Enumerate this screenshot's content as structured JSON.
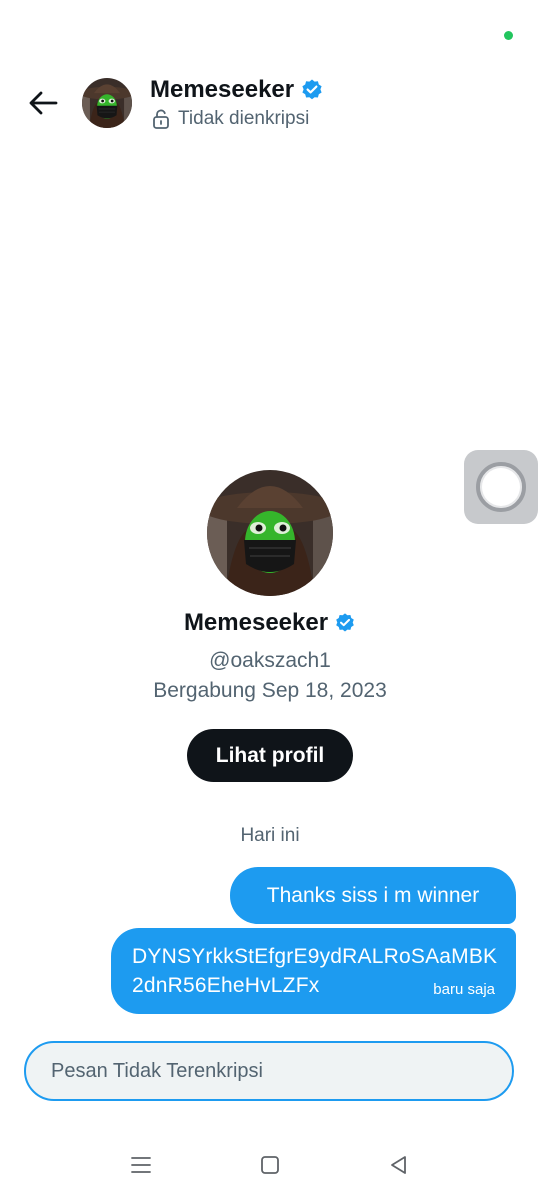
{
  "colors": {
    "accent": "#1d9bf0",
    "text": "#0f1419",
    "muted": "#536471",
    "status_dot": "#22c55e"
  },
  "header": {
    "name": "Memeseeker",
    "verified_icon": "verified-badge-icon",
    "encryption_icon": "unlocked-padlock-icon",
    "encryption_status": "Tidak dienkripsi"
  },
  "profile": {
    "name": "Memeseeker",
    "handle": "@oakszach1",
    "joined": "Bergabung Sep 18, 2023",
    "view_profile_label": "Lihat profil"
  },
  "conversation": {
    "day_label": "Hari ini",
    "messages": [
      {
        "text": "Thanks siss i m winner"
      },
      {
        "text": "DYNSYrkkStEfgrE9ydRALRoSAaMBK2dnR56EheHvLZFx",
        "time": "baru saja"
      }
    ]
  },
  "composer": {
    "placeholder": "Pesan Tidak Terenkripsi"
  },
  "navbar": {
    "icons": [
      "menu-icon",
      "home-square-icon",
      "back-triangle-icon"
    ]
  }
}
